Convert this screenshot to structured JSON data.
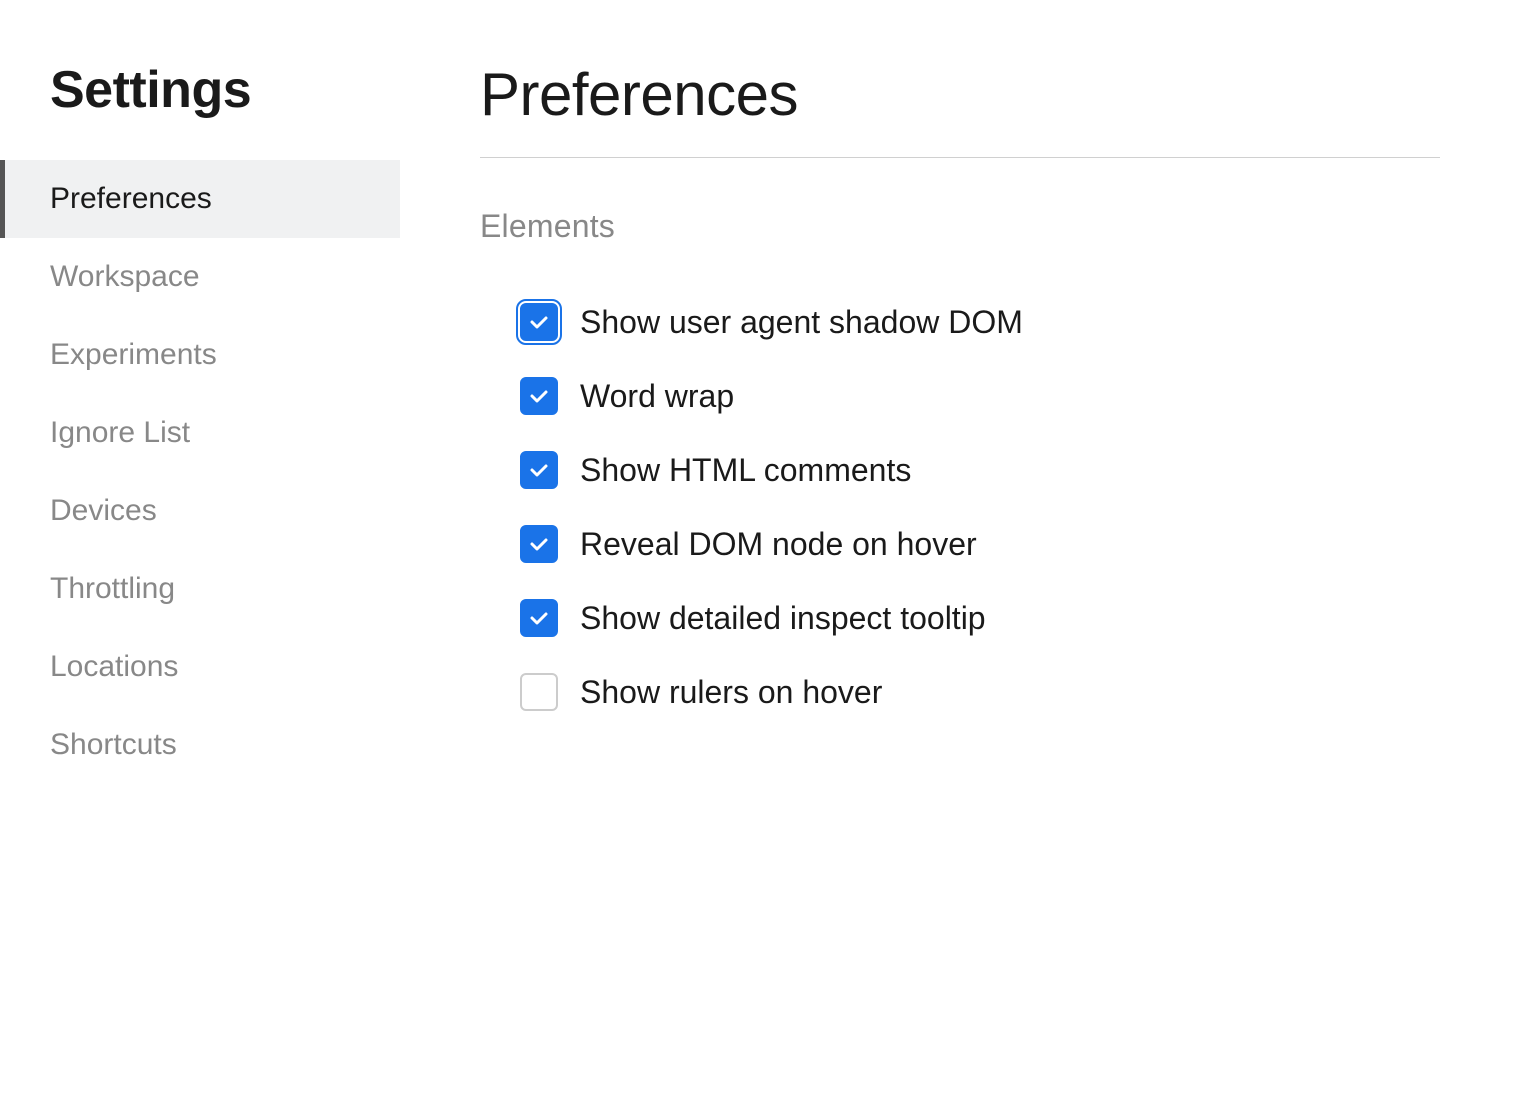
{
  "sidebar": {
    "title": "Settings",
    "nav_items": [
      {
        "id": "preferences",
        "label": "Preferences",
        "active": true
      },
      {
        "id": "workspace",
        "label": "Workspace",
        "active": false
      },
      {
        "id": "experiments",
        "label": "Experiments",
        "active": false
      },
      {
        "id": "ignore-list",
        "label": "Ignore List",
        "active": false
      },
      {
        "id": "devices",
        "label": "Devices",
        "active": false
      },
      {
        "id": "throttling",
        "label": "Throttling",
        "active": false
      },
      {
        "id": "locations",
        "label": "Locations",
        "active": false
      },
      {
        "id": "shortcuts",
        "label": "Shortcuts",
        "active": false
      }
    ]
  },
  "main": {
    "page_title": "Preferences",
    "sections": [
      {
        "id": "elements",
        "title": "Elements",
        "checkboxes": [
          {
            "id": "shadow-dom",
            "label": "Show user agent shadow DOM",
            "checked": true,
            "outlined": true
          },
          {
            "id": "word-wrap",
            "label": "Word wrap",
            "checked": true,
            "outlined": false
          },
          {
            "id": "html-comments",
            "label": "Show HTML comments",
            "checked": true,
            "outlined": false
          },
          {
            "id": "reveal-dom",
            "label": "Reveal DOM node on hover",
            "checked": true,
            "outlined": false
          },
          {
            "id": "inspect-tooltip",
            "label": "Show detailed inspect tooltip",
            "checked": true,
            "outlined": false
          },
          {
            "id": "rulers",
            "label": "Show rulers on hover",
            "checked": false,
            "outlined": false
          }
        ]
      }
    ]
  }
}
